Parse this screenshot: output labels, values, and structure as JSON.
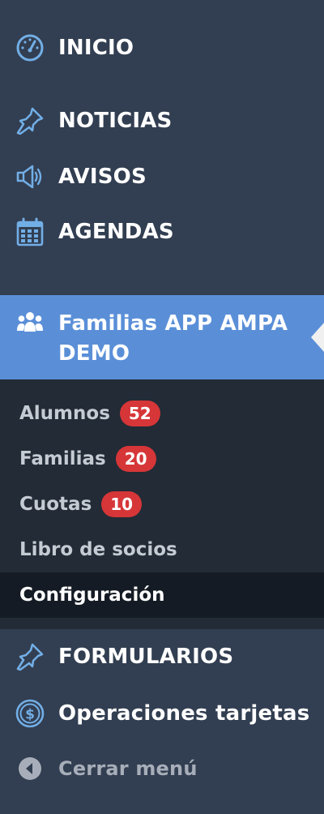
{
  "menu": {
    "inicio": {
      "label": "INICIO",
      "icon": "dashboard-gauge-icon"
    },
    "noticias": {
      "label": "NOTICIAS",
      "icon": "pushpin-icon"
    },
    "avisos": {
      "label": "AVISOS",
      "icon": "megaphone-icon"
    },
    "agendas": {
      "label": "AGENDAS",
      "icon": "calendar-icon"
    },
    "familias": {
      "label": "Familias APP AMPA DEMO",
      "icon": "group-users-icon"
    },
    "formularios": {
      "label": "FORMULARIOS",
      "icon": "pushpin-icon"
    },
    "operaciones": {
      "label": "Operaciones tarjetas",
      "icon": "dollar-circle-icon"
    },
    "cerrar": {
      "label": "Cerrar menú",
      "icon": "collapse-arrow-icon"
    }
  },
  "submenu": {
    "alumnos": {
      "label": "Alumnos",
      "badge": "52"
    },
    "familias": {
      "label": "Familias",
      "badge": "20"
    },
    "cuotas": {
      "label": "Cuotas",
      "badge": "10"
    },
    "libro": {
      "label": "Libro de socios"
    },
    "configuracion": {
      "label": "Configuración"
    }
  },
  "colors": {
    "sidebar_bg": "#323e51",
    "active_bg": "#5a8fd8",
    "submenu_bg": "#222b36",
    "current_sub_bg": "#151b24",
    "icon_blue": "#72aee6",
    "badge_red": "#d63638"
  }
}
